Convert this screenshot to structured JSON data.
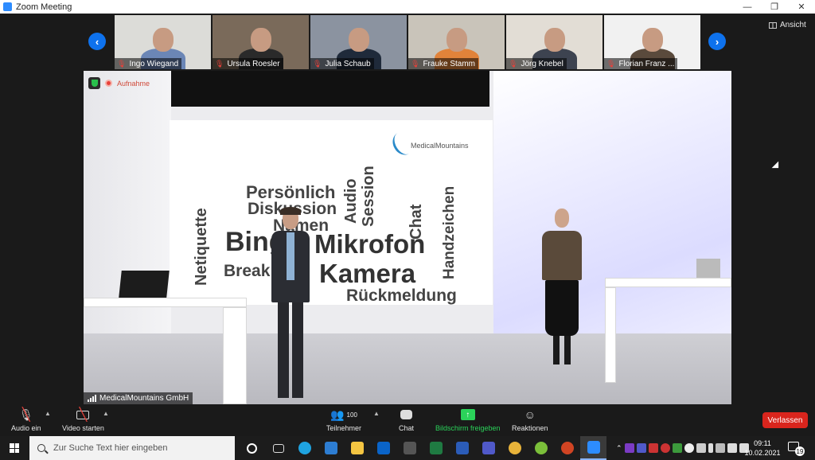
{
  "window": {
    "title": "Zoom Meeting",
    "minimize": "—",
    "restore": "❐",
    "close": "✕"
  },
  "view_button": "Ansicht",
  "participants": [
    {
      "name": "Ingo Wiegand",
      "bg": "#dcdcd8",
      "shirt": "#6b86b6"
    },
    {
      "name": "Ursula Roesler",
      "bg": "#7a6a5a",
      "shirt": "#2a2a2a"
    },
    {
      "name": "Julia Schaub",
      "bg": "#8b93a0",
      "shirt": "#1f2a3a"
    },
    {
      "name": "Frauke Stamm",
      "bg": "#c9c4ba",
      "shirt": "#e1833a"
    },
    {
      "name": "Jörg Knebel",
      "bg": "#e2ddd5",
      "shirt": "#3d4350"
    },
    {
      "name": "Florian Franz ...",
      "bg": "#f1f1f1",
      "shirt": "#5a4a3c"
    }
  ],
  "stage": {
    "recording_label": "Aufnahme",
    "speaker_label": "MedicalMountains GmbH",
    "logo_text": "MedicalMountains",
    "word_cloud": [
      {
        "w": "Persönlich"
      },
      {
        "w": "Diskussion"
      },
      {
        "w": "Namen"
      },
      {
        "w": "Bingo"
      },
      {
        "w": "Mikrofon"
      },
      {
        "w": "Kamera"
      },
      {
        "w": "Break"
      },
      {
        "w": "Rückmeldung"
      },
      {
        "w": "Netiquette"
      },
      {
        "w": "Audio"
      },
      {
        "w": "Session"
      },
      {
        "w": "Chat"
      },
      {
        "w": "Handzeichen"
      }
    ]
  },
  "toolbar": {
    "audio": "Audio ein",
    "video": "Video starten",
    "participants_label": "Teilnehmer",
    "participants_count": "100",
    "chat": "Chat",
    "share": "Bildschirm freigeben",
    "reactions": "Reaktionen",
    "leave": "Verlassen"
  },
  "taskbar": {
    "search_placeholder": "Zur Suche Text hier eingeben",
    "time": "09:11",
    "date": "10.02.2021",
    "notifications": "19",
    "apps": [
      {
        "name": "cortana-icon",
        "color": "#ffffff"
      },
      {
        "name": "task-view-icon",
        "color": "#dddddd"
      },
      {
        "name": "edge-icon",
        "color": "#1fa3e0"
      },
      {
        "name": "app-c-icon",
        "color": "#2d7dd2"
      },
      {
        "name": "explorer-icon",
        "color": "#f4c542"
      },
      {
        "name": "outlook-icon",
        "color": "#0a64c8"
      },
      {
        "name": "vpn-icon",
        "color": "#555555"
      },
      {
        "name": "excel-icon",
        "color": "#1f7a42"
      },
      {
        "name": "word-icon",
        "color": "#2b5cb8"
      },
      {
        "name": "teams-icon",
        "color": "#5059c9"
      },
      {
        "name": "chrome-icon",
        "color": "#e8b33a"
      },
      {
        "name": "app-y-icon",
        "color": "#7bbf3a"
      },
      {
        "name": "powerpoint-icon",
        "color": "#d04423"
      },
      {
        "name": "zoom-icon",
        "color": "#2d8cff"
      }
    ]
  }
}
